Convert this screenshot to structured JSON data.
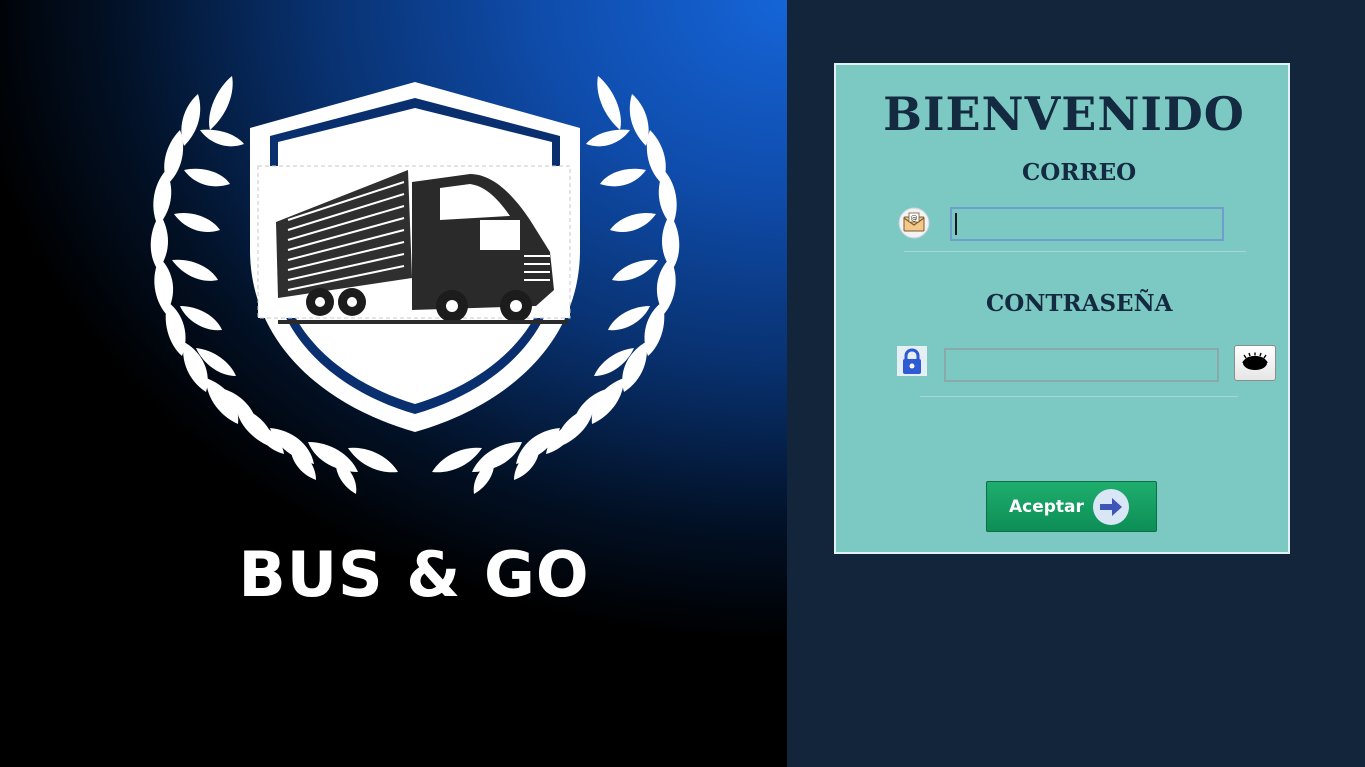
{
  "brand": {
    "name": "BUS & GO"
  },
  "login": {
    "title": "BIENVENIDO",
    "email_label": "CORREO",
    "email_value": "",
    "password_label": "CONTRASEÑA",
    "password_value": "",
    "submit_label": "Aceptar"
  },
  "icons": {
    "email": "envelope-icon",
    "password": "lock-icon",
    "toggle_password": "eye-icon",
    "submit": "arrow-right-icon"
  },
  "colors": {
    "card_background": "#7cc8c3",
    "right_background": "#13253b",
    "brand_blue": "#1565d8",
    "button_green": "#1fae6e",
    "title_text": "#142a40"
  }
}
